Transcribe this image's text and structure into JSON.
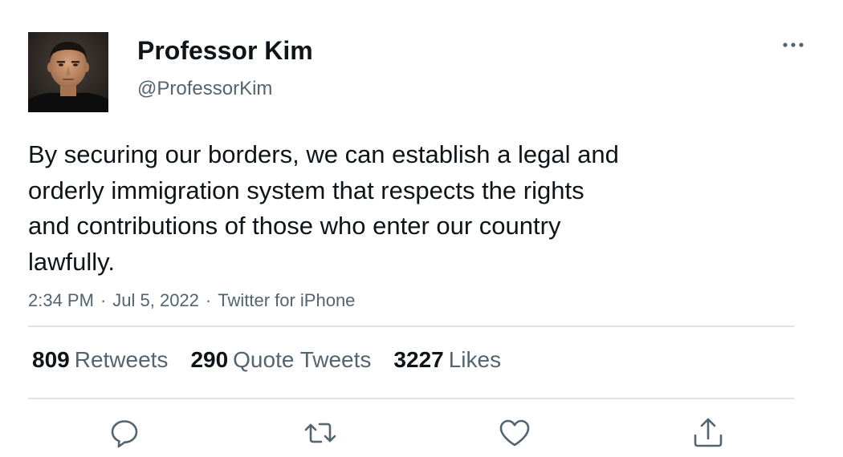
{
  "user": {
    "display_name": "Professor Kim",
    "handle": "@ProfessorKim",
    "avatar": "avatar-photo"
  },
  "tweet": {
    "text_lines": [
      "By securing our borders, we can establish a legal and",
      "orderly immigration system that respects the rights",
      "and contributions of those who enter our country",
      "lawfully."
    ],
    "time": "2:34 PM",
    "date": "Jul 5, 2022",
    "source": "Twitter for iPhone",
    "separator": "·"
  },
  "stats": [
    {
      "count": "809",
      "label": "Retweets"
    },
    {
      "count": "290",
      "label": "Quote Tweets"
    },
    {
      "count": "3227",
      "label": "Likes"
    }
  ],
  "actions": [
    {
      "name": "reply",
      "icon": "reply-icon"
    },
    {
      "name": "retweet",
      "icon": "retweet-icon"
    },
    {
      "name": "like",
      "icon": "heart-icon"
    },
    {
      "name": "share",
      "icon": "share-icon"
    }
  ],
  "menu": {
    "icon": "more-icon"
  },
  "colors": {
    "text": "#0f1419",
    "secondary": "#536471",
    "divider": "#dfe3e6"
  }
}
